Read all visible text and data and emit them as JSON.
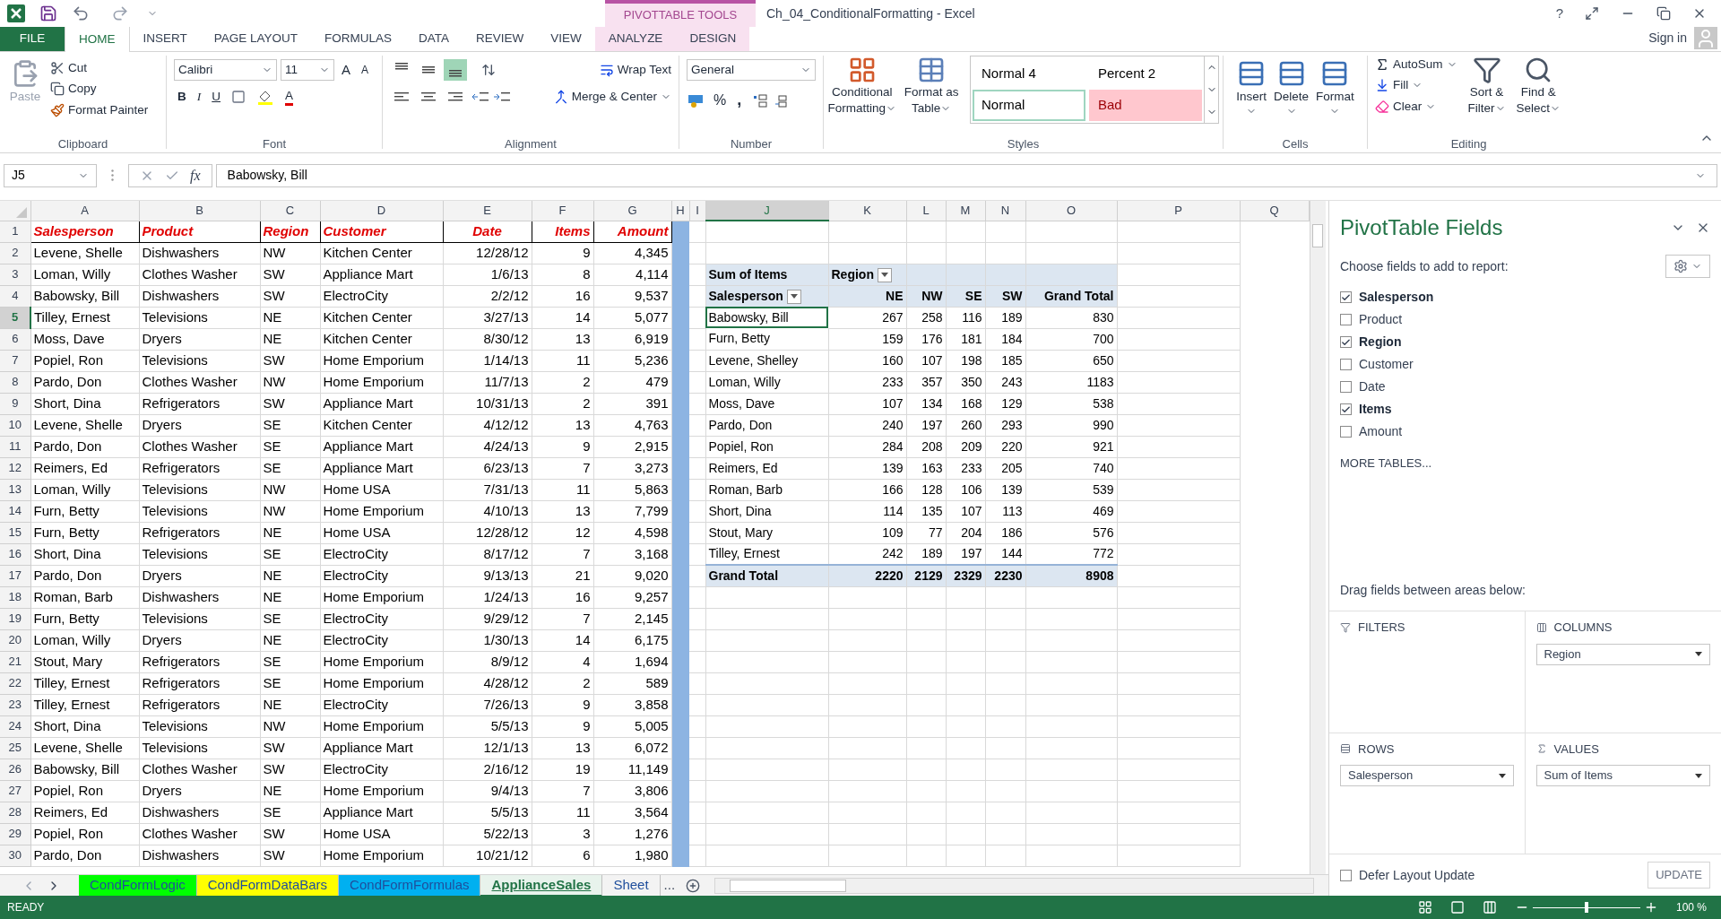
{
  "title_bar": {
    "title": "Ch_04_ConditionalFormatting - Excel",
    "context_label": "PIVOTTABLE TOOLS",
    "help": "?"
  },
  "tabs": [
    {
      "label": "FILE",
      "kind": "file",
      "selected": false
    },
    {
      "label": "HOME",
      "kind": "normal",
      "selected": true
    },
    {
      "label": "INSERT",
      "kind": "normal",
      "selected": false
    },
    {
      "label": "PAGE LAYOUT",
      "kind": "normal",
      "selected": false
    },
    {
      "label": "FORMULAS",
      "kind": "normal",
      "selected": false
    },
    {
      "label": "DATA",
      "kind": "normal",
      "selected": false
    },
    {
      "label": "REVIEW",
      "kind": "normal",
      "selected": false
    },
    {
      "label": "VIEW",
      "kind": "normal",
      "selected": false
    },
    {
      "label": "ANALYZE",
      "kind": "contextual",
      "selected": false
    },
    {
      "label": "DESIGN",
      "kind": "contextual",
      "selected": false
    }
  ],
  "sign_in": "Sign in",
  "clipboard": {
    "label": "Clipboard",
    "paste": {
      "label": "Paste",
      "disabled": true
    },
    "cut": "Cut",
    "copy": "Copy",
    "format_painter": "Format Painter"
  },
  "font": {
    "label": "Font",
    "name": "Calibri",
    "size": "11",
    "grow": "A",
    "shrink": "A",
    "bold": "B",
    "italic": "I",
    "underline": "U",
    "font_color": "A"
  },
  "alignment": {
    "label": "Alignment",
    "align_buttons": [
      {
        "kind": "top",
        "selected": false
      },
      {
        "kind": "middle",
        "selected": false
      },
      {
        "kind": "bottom",
        "selected": true
      }
    ],
    "wrap_text": "Wrap Text",
    "merge": "Merge & Center"
  },
  "number": {
    "label": "Number",
    "format": "General",
    "percent": "%",
    "comma": ","
  },
  "styles": {
    "label": "Styles",
    "conditional": [
      "Conditional",
      "Formatting"
    ],
    "format_table": [
      "Format as",
      "Table"
    ],
    "cells": [
      {
        "label": "Normal 4",
        "kind": "plain",
        "selected": false
      },
      {
        "label": "Percent 2",
        "kind": "plain",
        "selected": false
      },
      {
        "label": "Normal",
        "kind": "plain",
        "selected": true
      },
      {
        "label": "Bad",
        "kind": "bad",
        "selected": false
      }
    ]
  },
  "cells": {
    "label": "Cells",
    "buttons": [
      "Insert",
      "Delete",
      "Format"
    ]
  },
  "editing": {
    "label": "Editing",
    "autosum": "AutoSum",
    "fill": "Fill",
    "clear": "Clear",
    "sort": [
      "Sort &",
      "Filter"
    ],
    "find": [
      "Find &",
      "Select"
    ]
  },
  "formula_bar": {
    "name_box": "J5",
    "function_label": "fx",
    "value": "Babowsky, Bill"
  },
  "sheet": {
    "columns": [
      {
        "label": "A",
        "selected": false
      },
      {
        "label": "B",
        "selected": false
      },
      {
        "label": "C",
        "selected": false
      },
      {
        "label": "D",
        "selected": false
      },
      {
        "label": "E",
        "selected": false
      },
      {
        "label": "F",
        "selected": false
      },
      {
        "label": "G",
        "selected": false
      },
      {
        "label": "H",
        "selected": false
      },
      {
        "label": "I",
        "selected": false
      },
      {
        "label": "J",
        "selected": true
      },
      {
        "label": "K",
        "selected": false
      },
      {
        "label": "L",
        "selected": false
      },
      {
        "label": "M",
        "selected": false
      },
      {
        "label": "N",
        "selected": false
      },
      {
        "label": "O",
        "selected": false
      },
      {
        "label": "P",
        "selected": false
      },
      {
        "label": "Q",
        "selected": false
      }
    ],
    "rows": [
      {
        "number": "1",
        "kind": "header",
        "selected": false,
        "cells": [
          "Salesperson",
          "Product",
          "Region",
          "Customer",
          "Date",
          "Items",
          "Amount"
        ]
      },
      {
        "number": "2",
        "kind": "data",
        "selected": false,
        "cells": [
          "Levene, Shelle",
          "Dishwashers",
          "NW",
          "Kitchen Center",
          "12/28/12",
          "9",
          "4,345"
        ]
      },
      {
        "number": "3",
        "kind": "data",
        "selected": false,
        "cells": [
          "Loman, Willy",
          "Clothes Washer",
          "SW",
          "Appliance Mart",
          "1/6/13",
          "8",
          "4,114"
        ]
      },
      {
        "number": "4",
        "kind": "data",
        "selected": false,
        "cells": [
          "Babowsky, Bill",
          "Dishwashers",
          "SW",
          "ElectroCity",
          "2/2/12",
          "16",
          "9,537"
        ]
      },
      {
        "number": "5",
        "kind": "data",
        "selected": true,
        "cells": [
          "Tilley, Ernest",
          "Televisions",
          "NE",
          "Kitchen Center",
          "3/27/13",
          "14",
          "5,077"
        ]
      },
      {
        "number": "6",
        "kind": "data",
        "selected": false,
        "cells": [
          "Moss, Dave",
          "Dryers",
          "NE",
          "Kitchen Center",
          "8/30/12",
          "13",
          "6,919"
        ]
      },
      {
        "number": "7",
        "kind": "data",
        "selected": false,
        "cells": [
          "Popiel, Ron",
          "Televisions",
          "SW",
          "Home Emporium",
          "1/14/13",
          "11",
          "5,236"
        ]
      },
      {
        "number": "8",
        "kind": "data",
        "selected": false,
        "cells": [
          "Pardo, Don",
          "Clothes Washer",
          "NW",
          "Home Emporium",
          "11/7/13",
          "2",
          "479"
        ]
      },
      {
        "number": "9",
        "kind": "data",
        "selected": false,
        "cells": [
          "Short, Dina",
          "Refrigerators",
          "SW",
          "Appliance Mart",
          "10/31/13",
          "2",
          "391"
        ]
      },
      {
        "number": "10",
        "kind": "data",
        "selected": false,
        "cells": [
          "Levene, Shelle",
          "Dryers",
          "SE",
          "Kitchen Center",
          "4/12/12",
          "13",
          "4,763"
        ]
      },
      {
        "number": "11",
        "kind": "data",
        "selected": false,
        "cells": [
          "Pardo, Don",
          "Clothes Washer",
          "SE",
          "Appliance Mart",
          "4/24/13",
          "9",
          "2,915"
        ]
      },
      {
        "number": "12",
        "kind": "data",
        "selected": false,
        "cells": [
          "Reimers, Ed",
          "Refrigerators",
          "SE",
          "Appliance Mart",
          "6/23/13",
          "7",
          "3,273"
        ]
      },
      {
        "number": "13",
        "kind": "data",
        "selected": false,
        "cells": [
          "Loman, Willy",
          "Televisions",
          "NW",
          "Home USA",
          "7/31/13",
          "11",
          "5,863"
        ]
      },
      {
        "number": "14",
        "kind": "data",
        "selected": false,
        "cells": [
          "Furn, Betty",
          "Televisions",
          "NW",
          "Home Emporium",
          "4/10/13",
          "13",
          "7,799"
        ]
      },
      {
        "number": "15",
        "kind": "data",
        "selected": false,
        "cells": [
          "Furn, Betty",
          "Refrigerators",
          "NE",
          "Home USA",
          "12/28/12",
          "12",
          "4,598"
        ]
      },
      {
        "number": "16",
        "kind": "data",
        "selected": false,
        "cells": [
          "Short, Dina",
          "Televisions",
          "SE",
          "ElectroCity",
          "8/17/12",
          "7",
          "3,168"
        ]
      },
      {
        "number": "17",
        "kind": "data",
        "selected": false,
        "cells": [
          "Pardo, Don",
          "Dryers",
          "NE",
          "ElectroCity",
          "9/13/13",
          "21",
          "9,020"
        ]
      },
      {
        "number": "18",
        "kind": "data",
        "selected": false,
        "cells": [
          "Roman, Barb",
          "Dishwashers",
          "NE",
          "Home Emporium",
          "1/24/13",
          "16",
          "9,257"
        ]
      },
      {
        "number": "19",
        "kind": "data",
        "selected": false,
        "cells": [
          "Furn, Betty",
          "Televisions",
          "SE",
          "ElectroCity",
          "9/29/12",
          "7",
          "2,145"
        ]
      },
      {
        "number": "20",
        "kind": "data",
        "selected": false,
        "cells": [
          "Loman, Willy",
          "Dryers",
          "NE",
          "ElectroCity",
          "1/30/13",
          "14",
          "6,175"
        ]
      },
      {
        "number": "21",
        "kind": "data",
        "selected": false,
        "cells": [
          "Stout, Mary",
          "Refrigerators",
          "SE",
          "Home Emporium",
          "8/9/12",
          "4",
          "1,694"
        ]
      },
      {
        "number": "22",
        "kind": "data",
        "selected": false,
        "cells": [
          "Tilley, Ernest",
          "Refrigerators",
          "SE",
          "Home Emporium",
          "4/28/12",
          "2",
          "589"
        ]
      },
      {
        "number": "23",
        "kind": "data",
        "selected": false,
        "cells": [
          "Tilley, Ernest",
          "Refrigerators",
          "NE",
          "ElectroCity",
          "7/26/13",
          "9",
          "3,858"
        ]
      },
      {
        "number": "24",
        "kind": "data",
        "selected": false,
        "cells": [
          "Short, Dina",
          "Televisions",
          "NW",
          "Home Emporium",
          "5/5/13",
          "9",
          "5,005"
        ]
      },
      {
        "number": "25",
        "kind": "data",
        "selected": false,
        "cells": [
          "Levene, Shelle",
          "Televisions",
          "SW",
          "Appliance Mart",
          "12/1/13",
          "13",
          "6,072"
        ]
      },
      {
        "number": "26",
        "kind": "data",
        "selected": false,
        "cells": [
          "Babowsky, Bill",
          "Clothes Washer",
          "SW",
          "ElectroCity",
          "2/16/12",
          "19",
          "11,149"
        ]
      },
      {
        "number": "27",
        "kind": "data",
        "selected": false,
        "cells": [
          "Popiel, Ron",
          "Dryers",
          "NE",
          "Home Emporium",
          "9/4/13",
          "7",
          "3,806"
        ]
      },
      {
        "number": "28",
        "kind": "data",
        "selected": false,
        "cells": [
          "Reimers, Ed",
          "Dishwashers",
          "SE",
          "Appliance Mart",
          "5/5/13",
          "11",
          "3,564"
        ]
      },
      {
        "number": "29",
        "kind": "data",
        "selected": false,
        "cells": [
          "Popiel, Ron",
          "Clothes Washer",
          "SW",
          "Home USA",
          "5/22/13",
          "3",
          "1,276"
        ]
      },
      {
        "number": "30",
        "kind": "data",
        "selected": false,
        "cells": [
          "Pardo, Don",
          "Dishwashers",
          "SW",
          "Home Emporium",
          "10/21/12",
          "6",
          "1,980"
        ]
      }
    ]
  },
  "pivot": {
    "rows": [
      {
        "kind": "caption",
        "selected": false,
        "cells": [
          "Sum of Items",
          "Region"
        ]
      },
      {
        "kind": "header",
        "selected": false,
        "cells": [
          "Salesperson",
          "NE",
          "NW",
          "SE",
          "SW",
          "Grand Total"
        ]
      },
      {
        "kind": "data",
        "selected": true,
        "cells": [
          "Babowsky, Bill",
          "267",
          "258",
          "116",
          "189",
          "830"
        ]
      },
      {
        "kind": "data",
        "selected": false,
        "cells": [
          "Furn, Betty",
          "159",
          "176",
          "181",
          "184",
          "700"
        ]
      },
      {
        "kind": "data",
        "selected": false,
        "cells": [
          "Levene, Shelley",
          "160",
          "107",
          "198",
          "185",
          "650"
        ]
      },
      {
        "kind": "data",
        "selected": false,
        "cells": [
          "Loman, Willy",
          "233",
          "357",
          "350",
          "243",
          "1183"
        ]
      },
      {
        "kind": "data",
        "selected": false,
        "cells": [
          "Moss, Dave",
          "107",
          "134",
          "168",
          "129",
          "538"
        ]
      },
      {
        "kind": "data",
        "selected": false,
        "cells": [
          "Pardo, Don",
          "240",
          "197",
          "260",
          "293",
          "990"
        ]
      },
      {
        "kind": "data",
        "selected": false,
        "cells": [
          "Popiel, Ron",
          "284",
          "208",
          "209",
          "220",
          "921"
        ]
      },
      {
        "kind": "data",
        "selected": false,
        "cells": [
          "Reimers, Ed",
          "139",
          "163",
          "233",
          "205",
          "740"
        ]
      },
      {
        "kind": "data",
        "selected": false,
        "cells": [
          "Roman, Barb",
          "166",
          "128",
          "106",
          "139",
          "539"
        ]
      },
      {
        "kind": "data",
        "selected": false,
        "cells": [
          "Short, Dina",
          "114",
          "135",
          "107",
          "113",
          "469"
        ]
      },
      {
        "kind": "data",
        "selected": false,
        "cells": [
          "Stout, Mary",
          "109",
          "77",
          "204",
          "186",
          "576"
        ]
      },
      {
        "kind": "data",
        "selected": false,
        "cells": [
          "Tilley, Ernest",
          "242",
          "189",
          "197",
          "144",
          "772"
        ]
      },
      {
        "kind": "total",
        "selected": false,
        "cells": [
          "Grand Total",
          "2220",
          "2129",
          "2329",
          "2230",
          "8908"
        ]
      }
    ]
  },
  "sheet_tabs": [
    {
      "label": "CondFormLogic",
      "color": "#00ff00",
      "selected": false
    },
    {
      "label": "CondFormDataBars",
      "color": "#ffff00",
      "selected": false
    },
    {
      "label": "CondFormFormulas",
      "color": "#00b0f0",
      "selected": false
    },
    {
      "label": "ApplianceSales",
      "color": "#e8f3ec",
      "selected": true
    },
    {
      "label": "Sheet",
      "color": "#f3f3f3",
      "selected": false
    }
  ],
  "more_tabs": "...",
  "field_pane": {
    "title": "PivotTable Fields",
    "subtitle": "Choose fields to add to report:",
    "fields": [
      {
        "label": "Salesperson",
        "checked": true
      },
      {
        "label": "Product",
        "checked": false
      },
      {
        "label": "Region",
        "checked": true
      },
      {
        "label": "Customer",
        "checked": false
      },
      {
        "label": "Date",
        "checked": false
      },
      {
        "label": "Items",
        "checked": true
      },
      {
        "label": "Amount",
        "checked": false
      }
    ],
    "more_tables": "MORE TABLES...",
    "drag_hint": "Drag fields between areas below:",
    "areas": [
      {
        "kind": "filters",
        "label": "FILTERS"
      },
      {
        "kind": "columns",
        "label": "COLUMNS",
        "field": "Region"
      },
      {
        "kind": "rows",
        "label": "ROWS",
        "field": "Salesperson"
      },
      {
        "kind": "values",
        "label": "VALUES",
        "field": "Sum of Items"
      }
    ],
    "defer": {
      "label": "Defer Layout Update",
      "checked": false
    },
    "update": {
      "label": "UPDATE",
      "disabled": true
    }
  },
  "status_bar": {
    "status": "READY",
    "zoom": {
      "level": 0.5,
      "reading": "100 %"
    }
  }
}
